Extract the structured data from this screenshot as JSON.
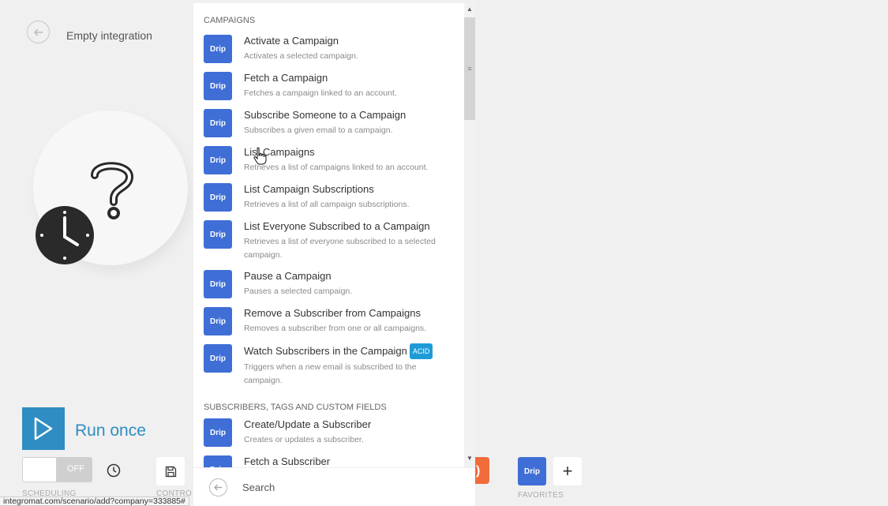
{
  "header": {
    "title": "Empty integration",
    "back_icon": "arrow-left-icon"
  },
  "run": {
    "label": "Run once",
    "icon": "play-icon"
  },
  "toolbar": {
    "toggle_label": "OFF",
    "scheduling_label": "SCHEDULING",
    "controls_label": "CONTRO",
    "favorites_label": "FAVORITES",
    "favorite_badge": "Drip",
    "add_icon": "+"
  },
  "status_url": "integromat.com/scenario/add?company=333885#",
  "panel": {
    "sections": [
      {
        "header": "CAMPAIGNS",
        "items": [
          {
            "badge": "Drip",
            "title": "Activate a Campaign",
            "desc": "Activates a selected campaign."
          },
          {
            "badge": "Drip",
            "title": "Fetch a Campaign",
            "desc": "Fetches a campaign linked to an account."
          },
          {
            "badge": "Drip",
            "title": "Subscribe Someone to a Campaign",
            "desc": "Subscribes a given email to a campaign."
          },
          {
            "badge": "Drip",
            "title": "List Campaigns",
            "desc": "Retrieves a list of campaigns linked to an account."
          },
          {
            "badge": "Drip",
            "title": "List Campaign Subscriptions",
            "desc": "Retrieves a list of all campaign subscriptions."
          },
          {
            "badge": "Drip",
            "title": "List Everyone Subscribed to a Campaign",
            "desc": "Retrieves a list of everyone subscribed to a selected campaign."
          },
          {
            "badge": "Drip",
            "title": "Pause a Campaign",
            "desc": "Pauses a selected campaign."
          },
          {
            "badge": "Drip",
            "title": "Remove a Subscriber from Campaigns",
            "desc": "Removes a subscriber from one or all campaigns."
          },
          {
            "badge": "Drip",
            "title": "Watch Subscribers in the Campaign",
            "tag": "ACID",
            "desc": "Triggers when a new email is subscribed to the campaign."
          }
        ]
      },
      {
        "header": "SUBSCRIBERS, TAGS AND CUSTOM FIELDS",
        "items": [
          {
            "badge": "Drip",
            "title": "Create/Update a Subscriber",
            "desc": "Creates or updates a subscriber."
          },
          {
            "badge": "Drip",
            "title": "Fetch a Subscriber",
            "desc": ""
          }
        ]
      }
    ]
  },
  "search": {
    "placeholder": "Search"
  },
  "colors": {
    "accent": "#2f8dc3",
    "drip": "#3f6ed6",
    "acid": "#1e9bd7",
    "orange": "#f26b3a"
  }
}
